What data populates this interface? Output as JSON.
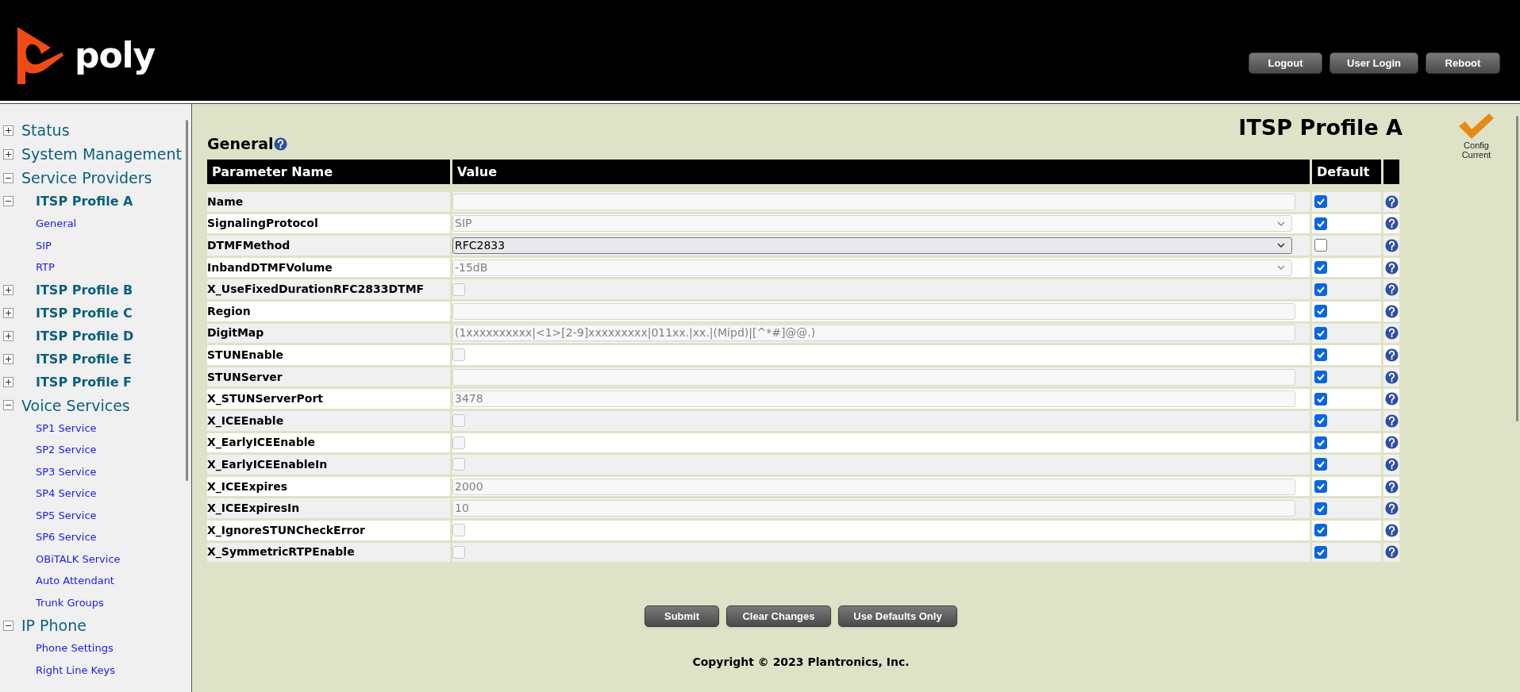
{
  "header": {
    "logo_text": "poly",
    "buttons": [
      "Logout",
      "User Login",
      "Reboot"
    ]
  },
  "sidebar": {
    "items": [
      {
        "label": "Status",
        "expanded": false
      },
      {
        "label": "System Management",
        "expanded": false
      },
      {
        "label": "Service Providers",
        "expanded": true,
        "children": [
          {
            "label": "ITSP Profile A",
            "expanded": true,
            "children": [
              {
                "label": "General"
              },
              {
                "label": "SIP"
              },
              {
                "label": "RTP"
              }
            ]
          },
          {
            "label": "ITSP Profile B",
            "expanded": false
          },
          {
            "label": "ITSP Profile C",
            "expanded": false
          },
          {
            "label": "ITSP Profile D",
            "expanded": false
          },
          {
            "label": "ITSP Profile E",
            "expanded": false
          },
          {
            "label": "ITSP Profile F",
            "expanded": false
          }
        ]
      },
      {
        "label": "Voice Services",
        "expanded": true,
        "children": [
          {
            "label": "SP1 Service"
          },
          {
            "label": "SP2 Service"
          },
          {
            "label": "SP3 Service"
          },
          {
            "label": "SP4 Service"
          },
          {
            "label": "SP5 Service"
          },
          {
            "label": "SP6 Service"
          },
          {
            "label": "OBiTALK Service"
          },
          {
            "label": "Auto Attendant"
          },
          {
            "label": "Trunk Groups"
          }
        ]
      },
      {
        "label": "IP Phone",
        "expanded": true,
        "children": [
          {
            "label": "Phone Settings"
          },
          {
            "label": "Right Line Keys"
          }
        ]
      }
    ]
  },
  "page_title": "ITSP Profile A",
  "section_title": "General",
  "config_status": "Config Current",
  "table": {
    "columns": [
      "Parameter Name",
      "Value",
      "Default"
    ],
    "rows": [
      {
        "name": "Name",
        "kind": "text",
        "value": "",
        "default": true
      },
      {
        "name": "SignalingProtocol",
        "kind": "select",
        "value": "SIP",
        "default": true
      },
      {
        "name": "DTMFMethod",
        "kind": "select",
        "value": "RFC2833",
        "default": false
      },
      {
        "name": "InbandDTMFVolume",
        "kind": "select",
        "value": "-15dB",
        "default": true
      },
      {
        "name": "X_UseFixedDurationRFC2833DTMF",
        "kind": "checkbox",
        "checked": false,
        "default": true
      },
      {
        "name": "Region",
        "kind": "text",
        "value": "",
        "default": true
      },
      {
        "name": "DigitMap",
        "kind": "text",
        "value": "(1xxxxxxxxxx|<1>[2-9]xxxxxxxxx|011xx.|xx.|(Mipd)|[^*#]@@.)",
        "default": true
      },
      {
        "name": "STUNEnable",
        "kind": "checkbox",
        "checked": false,
        "default": true
      },
      {
        "name": "STUNServer",
        "kind": "text",
        "value": "",
        "default": true
      },
      {
        "name": "X_STUNServerPort",
        "kind": "text",
        "value": "3478",
        "default": true
      },
      {
        "name": "X_ICEEnable",
        "kind": "checkbox",
        "checked": false,
        "default": true
      },
      {
        "name": "X_EarlyICEEnable",
        "kind": "checkbox",
        "checked": false,
        "default": true
      },
      {
        "name": "X_EarlyICEEnableIn",
        "kind": "checkbox",
        "checked": false,
        "default": true
      },
      {
        "name": "X_ICEExpires",
        "kind": "text",
        "value": "2000",
        "default": true
      },
      {
        "name": "X_ICEExpiresIn",
        "kind": "text",
        "value": "10",
        "default": true
      },
      {
        "name": "X_IgnoreSTUNCheckError",
        "kind": "checkbox",
        "checked": false,
        "default": true
      },
      {
        "name": "X_SymmetricRTPEnable",
        "kind": "checkbox",
        "checked": false,
        "default": true
      }
    ]
  },
  "actions": [
    "Submit",
    "Clear Changes",
    "Use Defaults Only"
  ],
  "footer": "Copyright © 2023 Plantronics, Inc."
}
